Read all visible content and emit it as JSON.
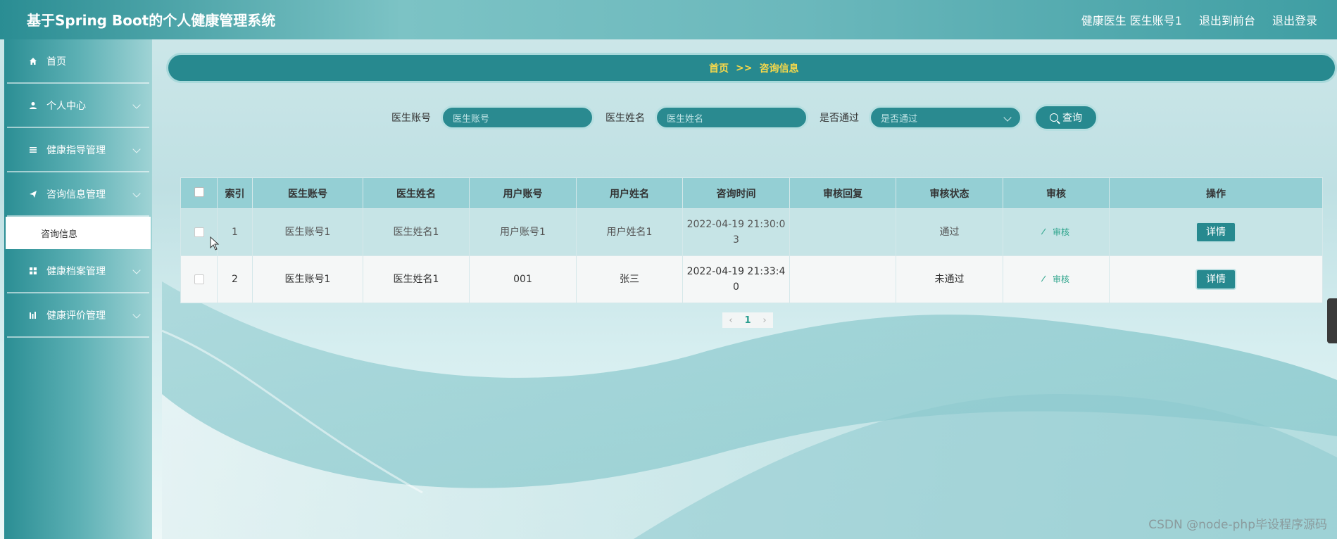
{
  "header": {
    "app_title": "基于Spring Boot的个人健康管理系统",
    "user_info": "健康医生 医生账号1",
    "back_to_front": "退出到前台",
    "logout": "退出登录"
  },
  "sidebar": {
    "items": [
      {
        "label": "首页",
        "icon": "home-icon"
      },
      {
        "label": "个人中心",
        "icon": "user-icon"
      },
      {
        "label": "健康指导管理",
        "icon": "list-icon"
      },
      {
        "label": "咨询信息管理",
        "icon": "send-icon"
      },
      {
        "label": "健康档案管理",
        "icon": "grid-icon"
      },
      {
        "label": "健康评价管理",
        "icon": "bar-icon"
      }
    ],
    "active_sub": "咨询信息"
  },
  "breadcrumb": {
    "home": "首页",
    "sep": ">>",
    "current": "咨询信息"
  },
  "search": {
    "doctor_account_label": "医生账号",
    "doctor_account_placeholder": "医生账号",
    "doctor_name_label": "医生姓名",
    "doctor_name_placeholder": "医生姓名",
    "passed_label": "是否通过",
    "passed_placeholder": "是否通过",
    "query_button": "查询"
  },
  "table": {
    "headers": [
      "索引",
      "医生账号",
      "医生姓名",
      "用户账号",
      "用户姓名",
      "咨询时间",
      "审核回复",
      "审核状态",
      "审核",
      "操作"
    ],
    "rows": [
      {
        "index": "1",
        "doctor_account": "医生账号1",
        "doctor_name": "医生姓名1",
        "user_account": "用户账号1",
        "user_name": "用户姓名1",
        "time_l1": "2022-04-19 21:30:0",
        "time_l2": "3",
        "reply": "",
        "status": "通过",
        "audit": "审核",
        "action": "详情"
      },
      {
        "index": "2",
        "doctor_account": "医生账号1",
        "doctor_name": "医生姓名1",
        "user_account": "001",
        "user_name": "张三",
        "time_l1": "2022-04-19 21:33:4",
        "time_l2": "0",
        "reply": "",
        "status": "未通过",
        "audit": "审核",
        "action": "详情"
      }
    ]
  },
  "pagination": {
    "prev": "‹",
    "current": "1",
    "next": "›"
  },
  "watermark": "CSDN @node-php毕设程序源码",
  "colors": {
    "primary": "#27898f",
    "breadcrumb_text": "#f6d84a",
    "audit_link": "#2aa38a"
  }
}
